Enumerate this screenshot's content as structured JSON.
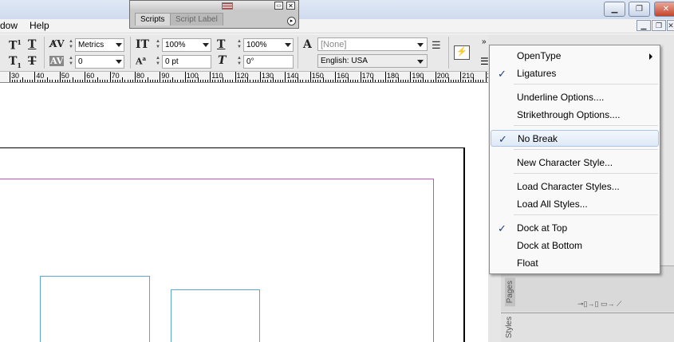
{
  "menubar": {
    "items": [
      "dow",
      "Help"
    ]
  },
  "scripts_panel": {
    "tabs": [
      "Scripts",
      "Script Label"
    ]
  },
  "control": {
    "tracking_method": "Metrics",
    "tracking_value": "0",
    "vscale": "100%",
    "hscale": "100%",
    "baseline": "0 pt",
    "skew": "0°",
    "char_style": "[None]",
    "language": "English: USA"
  },
  "ruler": {
    "labels": [
      "30",
      "40",
      "50",
      "60",
      "70",
      "80",
      "90",
      "100",
      "110",
      "120",
      "130",
      "140",
      "150",
      "160",
      "170",
      "180",
      "190",
      "200",
      "210",
      "220"
    ]
  },
  "context_menu": {
    "items": [
      {
        "label": "OpenType",
        "checked": false,
        "submenu": true
      },
      {
        "label": "Ligatures",
        "checked": true
      },
      {
        "label": "Underline Options....",
        "checked": false
      },
      {
        "label": "Strikethrough Options....",
        "checked": false
      },
      {
        "label": "No Break",
        "checked": true,
        "highlighted": true
      },
      {
        "label": "New Character Style...",
        "checked": false
      },
      {
        "label": "Load Character Styles...",
        "checked": false
      },
      {
        "label": "Load All Styles...",
        "checked": false
      },
      {
        "label": "Dock at Top",
        "checked": true
      },
      {
        "label": "Dock at Bottom",
        "checked": false
      },
      {
        "label": "Float",
        "checked": false
      }
    ]
  },
  "right_dock": {
    "pages_tab": "Pages",
    "styles_tab": "Styles"
  },
  "colors": {
    "margin_guide": "#c84fc8",
    "frame": "#5aa5d6",
    "check": "#1c3f7c"
  }
}
